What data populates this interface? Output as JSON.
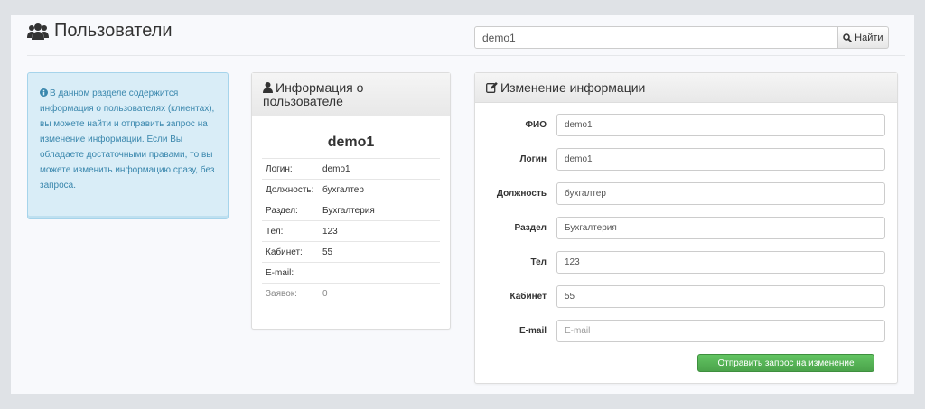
{
  "header": {
    "title": "Пользователи",
    "icon": "users-icon"
  },
  "search": {
    "value": "demo1",
    "button_label": "Найти",
    "button_icon": "search-icon"
  },
  "alert": {
    "icon": "info-icon",
    "text": "В данном разделе содержится информация о пользователях (клиентах), вы можете найти и отправить запрос на изменение информации. Если Вы обладаете достаточными правами, то вы можете изменить информацию сразу, без запроса.",
    "color": "#3a87ad"
  },
  "user_panel": {
    "title": "Информация о пользователе",
    "icon": "user-icon",
    "name": "demo1",
    "rows": [
      {
        "key": "Логин:",
        "value": "demo1"
      },
      {
        "key": "Должность:",
        "value": "бухгалтер"
      },
      {
        "key": "Раздел:",
        "value": "Бухгалтерия"
      },
      {
        "key": "Тел:",
        "value": "123"
      },
      {
        "key": "Кабинет:",
        "value": "55"
      },
      {
        "key": "E-mail:",
        "value": ""
      },
      {
        "key": "Заявок:",
        "value": "0"
      }
    ]
  },
  "edit_panel": {
    "title": "Изменение информации",
    "icon": "edit-icon",
    "fields": [
      {
        "label": "ФИО",
        "value": "demo1",
        "placeholder": ""
      },
      {
        "label": "Логин",
        "value": "demo1",
        "placeholder": ""
      },
      {
        "label": "Должность",
        "value": "бухгалтер",
        "placeholder": ""
      },
      {
        "label": "Раздел",
        "value": "Бухгалтерия",
        "placeholder": ""
      },
      {
        "label": "Тел",
        "value": "123",
        "placeholder": ""
      },
      {
        "label": "Кабинет",
        "value": "55",
        "placeholder": ""
      },
      {
        "label": "E-mail",
        "value": "",
        "placeholder": "E-mail"
      }
    ],
    "submit_label": "Отправить запрос на изменение",
    "submit_color": "#5bb75b"
  }
}
